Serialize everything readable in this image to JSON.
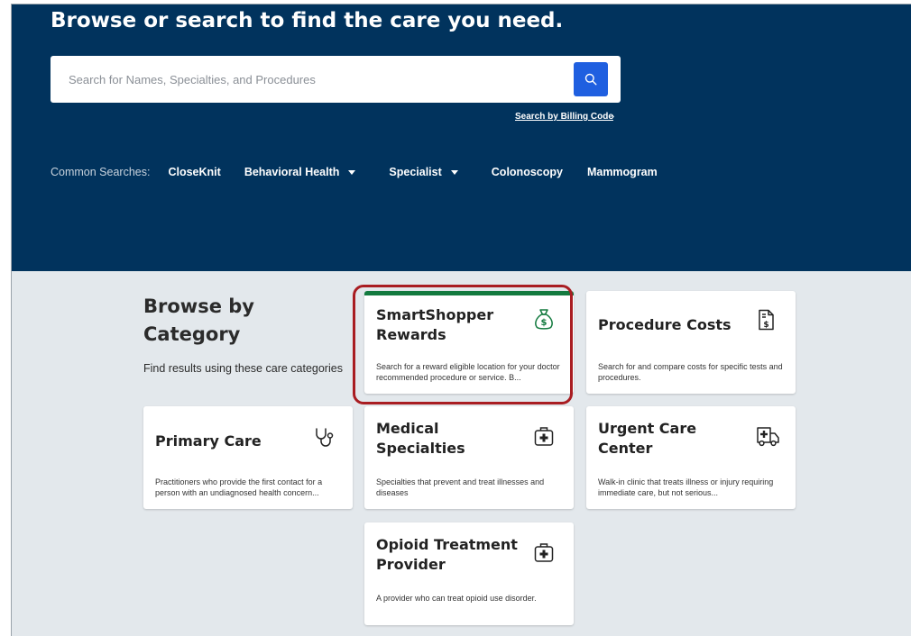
{
  "hero": {
    "title": "Browse or search to find the care you need.",
    "search": {
      "placeholder": "Search for Names, Specialties, and Procedures",
      "value": ""
    },
    "billing_link": "Search by Billing Code",
    "common_searches": {
      "label": "Common Searches:",
      "items": [
        {
          "label": "CloseKnit",
          "dropdown": false
        },
        {
          "label": "Behavioral Health",
          "dropdown": true
        },
        {
          "label": "Specialist",
          "dropdown": true
        },
        {
          "label": "Colonoscopy",
          "dropdown": false
        },
        {
          "label": "Mammogram",
          "dropdown": false
        }
      ]
    }
  },
  "browse": {
    "heading": "Browse by Category",
    "subtitle": "Find results using these care categories",
    "cards": [
      {
        "title": "SmartShopper Rewards",
        "description": "Search for a reward eligible location for your doctor recommended procedure or service. B...",
        "icon": "money-bag-icon",
        "featured": true
      },
      {
        "title": "Procedure Costs",
        "description": "Search for and compare costs for specific tests and procedures.",
        "icon": "billing-document-icon"
      },
      {
        "title": "Primary Care",
        "description": "Practitioners who provide the first contact for a person with an undiagnosed health concern...",
        "icon": "stethoscope-icon"
      },
      {
        "title": "Medical Specialties",
        "description": "Specialties that prevent and treat illnesses and diseases",
        "icon": "medical-kit-icon"
      },
      {
        "title": "Urgent Care Center",
        "description": "Walk-in clinic that treats illness or injury requiring immediate care, but not serious...",
        "icon": "ambulance-icon"
      },
      {
        "title": "Opioid Treatment Provider",
        "description": "A provider who can treat opioid use disorder.",
        "icon": "medical-kit-icon"
      }
    ]
  },
  "colors": {
    "hero_background": "#01335d",
    "search_button": "#1f5fe0",
    "page_background": "#e3e8ec",
    "featured_accent": "#137a3f",
    "highlight_ring": "#a91d22"
  }
}
